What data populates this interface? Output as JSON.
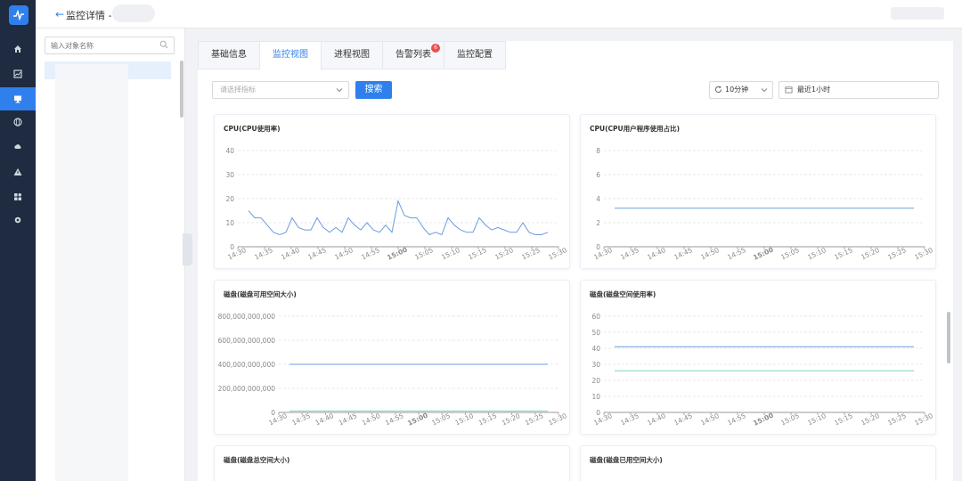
{
  "header": {
    "back_icon": "arrow-left-icon",
    "title": "监控详情 - 1"
  },
  "sidebar": {
    "items": [
      {
        "icon": "home-icon"
      },
      {
        "icon": "chart-icon"
      },
      {
        "icon": "monitor-icon",
        "active": true
      },
      {
        "icon": "globe-icon"
      },
      {
        "icon": "cloud-icon"
      },
      {
        "icon": "alert-icon"
      },
      {
        "icon": "apps-icon"
      },
      {
        "icon": "settings-icon"
      }
    ]
  },
  "tree": {
    "search_placeholder": "输入对象名称"
  },
  "tabs": [
    {
      "label": "基础信息"
    },
    {
      "label": "监控视图",
      "active": true
    },
    {
      "label": "进程视图"
    },
    {
      "label": "告警列表",
      "badge": "6"
    },
    {
      "label": "监控配置"
    }
  ],
  "toolbar": {
    "metric_placeholder": "请选择指标",
    "search_label": "搜索",
    "refresh_label": "10分钟",
    "time_range_label": "最近1小时"
  },
  "colors": {
    "accent": "#2f80ed",
    "line_blue": "#6b9be0",
    "line_green": "#7fd6b2",
    "badge": "#ee4d4d"
  },
  "chart_data": [
    {
      "type": "line",
      "title": "CPU(CPU使用率)",
      "x": [
        "14:30",
        "14:35",
        "14:40",
        "14:45",
        "14:50",
        "14:55",
        "15:00",
        "15:05",
        "15:10",
        "15:15",
        "15:20",
        "15:25",
        "15:30"
      ],
      "yticks": [
        "0",
        "10",
        "20",
        "30",
        "40"
      ],
      "ylim": [
        0,
        40
      ],
      "series": [
        {
          "values": [
            15,
            12,
            12,
            9,
            6,
            5,
            6,
            12,
            8,
            7,
            7,
            12,
            8,
            6,
            8,
            6,
            12,
            9,
            7,
            10,
            7,
            6,
            9,
            6,
            19,
            13,
            12,
            12,
            8,
            5,
            6,
            5,
            12,
            9,
            7,
            6,
            6,
            12,
            9,
            7,
            8,
            7,
            6,
            6,
            10,
            6,
            5,
            5,
            6
          ]
        }
      ]
    },
    {
      "type": "line",
      "title": "CPU(CPU用户程序使用占比)",
      "x": [
        "14:30",
        "14:35",
        "14:40",
        "14:45",
        "14:50",
        "14:55",
        "15:00",
        "15:05",
        "15:10",
        "15:15",
        "15:20",
        "15:25",
        "15:30"
      ],
      "yticks": [
        "0",
        "2",
        "4",
        "6",
        "8"
      ],
      "ylim": [
        0,
        8
      ],
      "series": [
        {
          "values": [
            3.2,
            3.2
          ]
        }
      ]
    },
    {
      "type": "line",
      "title": "磁盘(磁盘可用空间大小)",
      "x": [
        "14:30",
        "14:35",
        "14:40",
        "14:45",
        "14:50",
        "14:55",
        "15:00",
        "15:05",
        "15:10",
        "15:15",
        "15:20",
        "15:25",
        "15:30"
      ],
      "yticks": [
        "0",
        "200,000,000,000",
        "400,000,000,000",
        "600,000,000,000",
        "800,000,000,000"
      ],
      "ylim": [
        0,
        800000000000
      ],
      "series": [
        {
          "values": [
            400000000000,
            400000000000
          ]
        },
        {
          "values": [
            12000000000,
            12000000000
          ]
        }
      ]
    },
    {
      "type": "line",
      "title": "磁盘(磁盘空间使用率)",
      "x": [
        "14:30",
        "14:35",
        "14:40",
        "14:45",
        "14:50",
        "14:55",
        "15:00",
        "15:05",
        "15:10",
        "15:15",
        "15:20",
        "15:25",
        "15:30"
      ],
      "yticks": [
        "0",
        "10",
        "20",
        "30",
        "40",
        "50",
        "60"
      ],
      "ylim": [
        0,
        60
      ],
      "series": [
        {
          "values": [
            41,
            41
          ]
        },
        {
          "values": [
            26,
            26
          ]
        }
      ]
    },
    {
      "type": "line",
      "title": "磁盘(磁盘总空间大小)",
      "x": [],
      "series": []
    },
    {
      "type": "line",
      "title": "磁盘(磁盘已用空间大小)",
      "x": [],
      "series": []
    }
  ]
}
